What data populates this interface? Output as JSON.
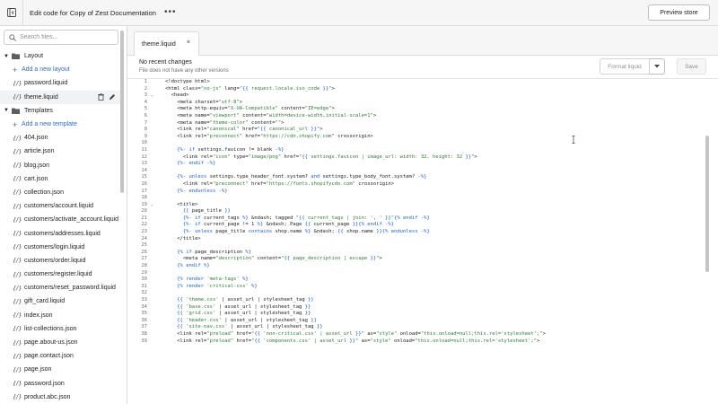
{
  "topbar": {
    "title": "Edit code for Copy of Zest Documentation",
    "menu_glyph": "•••",
    "preview_label": "Preview store"
  },
  "sidebar": {
    "search_placeholder": "Search files...",
    "folders": [
      {
        "name": "Layout",
        "add_label": "Add a new layout",
        "files": [
          "password.liquid",
          "theme.liquid"
        ]
      },
      {
        "name": "Templates",
        "add_label": "Add a new template",
        "files": [
          "404.json",
          "article.json",
          "blog.json",
          "cart.json",
          "collection.json",
          "customers/account.liquid",
          "customers/activate_account.liquid",
          "customers/addresses.liquid",
          "customers/login.liquid",
          "customers/order.liquid",
          "customers/register.liquid",
          "customers/reset_password.liquid",
          "gift_card.liquid",
          "index.json",
          "list-collections.json",
          "page.about-us.json",
          "page.contact.json",
          "page.json",
          "password.json",
          "product.abc.json"
        ]
      }
    ],
    "file_icon_glyph": "{/}",
    "active_file": "theme.liquid"
  },
  "editor": {
    "tab_label": "theme.liquid",
    "tab_close": "×",
    "info_title": "No recent changes",
    "info_subtitle": "File does not have any other versions",
    "format_label": "Format liquid",
    "save_label": "Save"
  },
  "code_lines": [
    {
      "n": "1",
      "t": "<!doctype html>"
    },
    {
      "n": "2",
      "t": "<html class=\"no-js\" lang=\"{{ request.locale.iso_code }}\">"
    },
    {
      "n": "3",
      "t": "  <head>",
      "fold": true
    },
    {
      "n": "4",
      "t": "    <meta charset=\"utf-8\">"
    },
    {
      "n": "5",
      "t": "    <meta http-equiv=\"X-UA-Compatible\" content=\"IE=edge\">"
    },
    {
      "n": "6",
      "t": "    <meta name=\"viewport\" content=\"width=device-width,initial-scale=1\">"
    },
    {
      "n": "7",
      "t": "    <meta name=\"theme-color\" content=\"\">"
    },
    {
      "n": "8",
      "t": "    <link rel=\"canonical\" href=\"{{ canonical_url }}\">"
    },
    {
      "n": "9",
      "t": "    <link rel=\"preconnect\" href=\"https://cdn.shopify.com\" crossorigin>"
    },
    {
      "n": "10",
      "t": ""
    },
    {
      "n": "11",
      "t": "    {%- if settings.favicon != blank -%}"
    },
    {
      "n": "12",
      "t": "      <link rel=\"icon\" type=\"image/png\" href=\"{{ settings.favicon | image_url: width: 32, height: 32 }}\">"
    },
    {
      "n": "13",
      "t": "    {%- endif -%}"
    },
    {
      "n": "14",
      "t": ""
    },
    {
      "n": "15",
      "t": "    {%- unless settings.type_header_font.system? and settings.type_body_font.system? -%}"
    },
    {
      "n": "16",
      "t": "      <link rel=\"preconnect\" href=\"https://fonts.shopifycdn.com\" crossorigin>"
    },
    {
      "n": "17",
      "t": "    {%- endunless -%}"
    },
    {
      "n": "18",
      "t": ""
    },
    {
      "n": "19",
      "t": "    <title>",
      "fold": true
    },
    {
      "n": "20",
      "t": "      {{ page_title }}"
    },
    {
      "n": "21",
      "t": "      {%- if current_tags %} &ndash; tagged \"{{ current_tags | join: ', ' }}\"{% endif -%}"
    },
    {
      "n": "22",
      "t": "      {%- if current_page != 1 %} &ndash; Page {{ current_page }}{% endif -%}"
    },
    {
      "n": "23",
      "t": "      {%- unless page_title contains shop.name %} &ndash; {{ shop.name }}{% endunless -%}"
    },
    {
      "n": "24",
      "t": "    </title>"
    },
    {
      "n": "25",
      "t": ""
    },
    {
      "n": "26",
      "t": "    {% if page_description %}"
    },
    {
      "n": "27",
      "t": "      <meta name=\"description\" content=\"{{ page_description | escape }}\">"
    },
    {
      "n": "28",
      "t": "    {% endif %}"
    },
    {
      "n": "29",
      "t": ""
    },
    {
      "n": "30",
      "t": "    {% render 'meta-tags' %}"
    },
    {
      "n": "31",
      "t": "    {% render 'critical-css' %}"
    },
    {
      "n": "32",
      "t": ""
    },
    {
      "n": "33",
      "t": "    {{ 'theme.css' | asset_url | stylesheet_tag }}"
    },
    {
      "n": "34",
      "t": "    {{ 'base.css' | asset_url | stylesheet_tag }}"
    },
    {
      "n": "35",
      "t": "    {{ 'grid.css' | asset_url | stylesheet_tag }}"
    },
    {
      "n": "36",
      "t": "    {{ 'header.css' | asset_url | stylesheet_tag }}"
    },
    {
      "n": "37",
      "t": "    {{ 'site-nav.css' | asset_url | stylesheet_tag }}"
    },
    {
      "n": "38",
      "t": "    <link rel=\"preload\" href=\"{{ 'non-critical.css' | asset_url }}\" as=\"style\" onload=\"this.onload=null;this.rel='stylesheet';\">"
    },
    {
      "n": "39",
      "t": "    <link rel=\"preload\" href=\"{{ 'components.css' | asset_url }}\" as=\"style\" onload=\"this.onload=null;this.rel='stylesheet';\">"
    }
  ],
  "colors": {
    "link": "#2c6ecb",
    "string": "#2e7d32",
    "liquid_keyword": "#1565c0"
  }
}
